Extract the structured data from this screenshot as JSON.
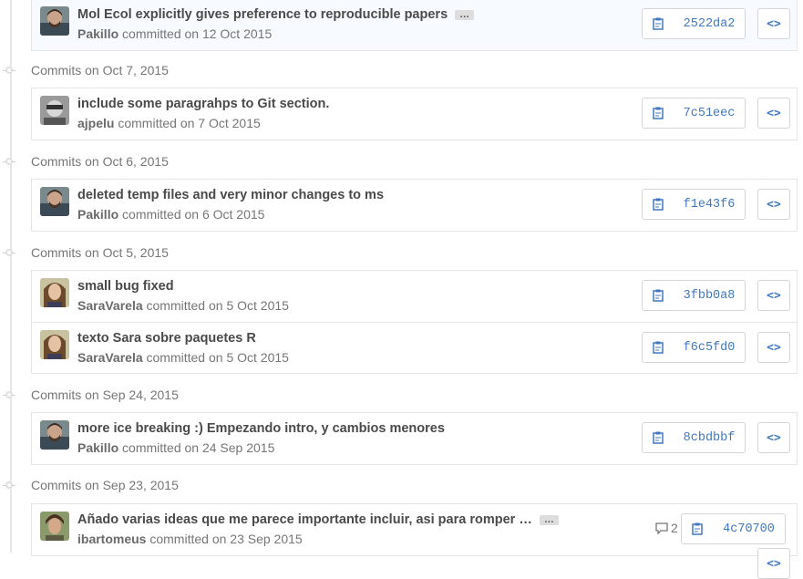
{
  "groups": [
    {
      "header": "",
      "commits": [
        {
          "message": "Mol Ecol explicitly gives preference to reproducible papers",
          "truncated": true,
          "author": "Pakillo",
          "date": "committed on 12 Oct 2015",
          "sha": "2522da2",
          "avatar": "pakillo"
        }
      ]
    },
    {
      "header": "Commits on Oct 7, 2015",
      "commits": [
        {
          "message": "include some paragrahps to Git section.",
          "truncated": false,
          "author": "ajpelu",
          "date": "committed on 7 Oct 2015",
          "sha": "7c51eec",
          "avatar": "ajpelu"
        }
      ]
    },
    {
      "header": "Commits on Oct 6, 2015",
      "commits": [
        {
          "message": "deleted temp files and very minor changes to ms",
          "truncated": false,
          "author": "Pakillo",
          "date": "committed on 6 Oct 2015",
          "sha": "f1e43f6",
          "avatar": "pakillo"
        }
      ]
    },
    {
      "header": "Commits on Oct 5, 2015",
      "commits": [
        {
          "message": "small bug fixed",
          "truncated": false,
          "author": "SaraVarela",
          "date": "committed on 5 Oct 2015",
          "sha": "3fbb0a8",
          "avatar": "sara"
        },
        {
          "message": "texto Sara sobre paquetes R",
          "truncated": false,
          "author": "SaraVarela",
          "date": "committed on 5 Oct 2015",
          "sha": "f6c5fd0",
          "avatar": "sara"
        }
      ]
    },
    {
      "header": "Commits on Sep 24, 2015",
      "commits": [
        {
          "message": "more ice breaking :) Empezando intro, y cambios menores",
          "truncated": false,
          "author": "Pakillo",
          "date": "committed on 24 Sep 2015",
          "sha": "8cbdbbf",
          "avatar": "pakillo"
        }
      ]
    },
    {
      "header": "Commits on Sep 23, 2015",
      "commits": [
        {
          "message": "Añado varias ideas que me parece importante incluir, asi para romper …",
          "truncated": true,
          "author": "ibartomeus",
          "date": "committed on 23 Sep 2015",
          "sha": "4c70700",
          "avatar": "ibartomeus",
          "comment_count": "2"
        }
      ]
    }
  ],
  "labels": {
    "ellipsis": "…",
    "browse": "<>"
  },
  "colors": {
    "link": "#4078c0",
    "border": "#e5e5e5",
    "muted": "#767676",
    "highlight_bg": "#f7fbff"
  }
}
